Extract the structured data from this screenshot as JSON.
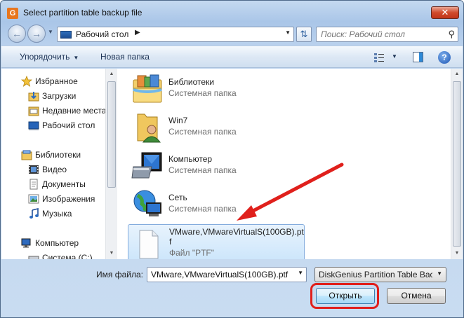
{
  "window": {
    "title": "Select partition table backup file",
    "close_symbol": "✕"
  },
  "navbar": {
    "address": "Рабочий стол",
    "search_placeholder": "Поиск: Рабочий стол"
  },
  "toolbar": {
    "organize_label": "Упорядочить",
    "new_folder_label": "Новая папка"
  },
  "sidebar": {
    "items": [
      {
        "label": "Избранное",
        "icon": "star-icon"
      },
      {
        "label": "Загрузки",
        "icon": "downloads-icon"
      },
      {
        "label": "Недавние места",
        "icon": "recent-places-icon"
      },
      {
        "label": "Рабочий стол",
        "icon": "desktop-icon"
      },
      {
        "label": "Библиотеки",
        "icon": "libraries-icon"
      },
      {
        "label": "Видео",
        "icon": "video-icon"
      },
      {
        "label": "Документы",
        "icon": "documents-icon"
      },
      {
        "label": "Изображения",
        "icon": "pictures-icon"
      },
      {
        "label": "Музыка",
        "icon": "music-icon"
      },
      {
        "label": "Компьютер",
        "icon": "computer-icon"
      },
      {
        "label": "Система (C:)",
        "icon": "drive-icon"
      }
    ]
  },
  "files": [
    {
      "name": "Библиотеки",
      "type": "Системная папка",
      "icon": "libraries-folder-icon"
    },
    {
      "name": "Win7",
      "type": "Системная папка",
      "icon": "user-folder-icon"
    },
    {
      "name": "Компьютер",
      "type": "Системная папка",
      "icon": "computer-icon"
    },
    {
      "name": "Сеть",
      "type": "Системная папка",
      "icon": "network-icon"
    },
    {
      "name_line1": "VMware,VMwareVirtualS(100GB).pt",
      "name_line2": "f",
      "type": "Файл \"PTF\"",
      "icon": "file-icon"
    }
  ],
  "footer": {
    "filename_label": "Имя файла:",
    "filename_value": "VMware,VMwareVirtualS(100GB).ptf",
    "filetype_value": "DiskGenius Partition Table Back",
    "open_label": "Открыть",
    "cancel_label": "Отмена"
  },
  "colors": {
    "annotation_red": "#e0201c",
    "selection_border": "#84acdd"
  }
}
